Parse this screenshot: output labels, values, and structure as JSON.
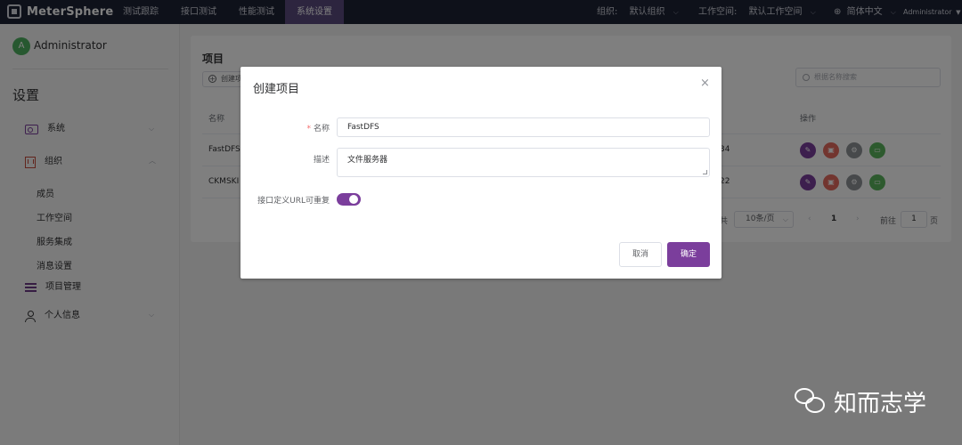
{
  "brand": {
    "name": "MeterSphere"
  },
  "nav": {
    "items": [
      "测试跟踪",
      "接口测试",
      "性能测试",
      "系统设置"
    ],
    "active_index": 3,
    "org_label": "组织:",
    "org_value": "默认组织",
    "workspace_label": "工作空间:",
    "workspace_value": "默认工作空间",
    "language": "简体中文",
    "user": "Administrator"
  },
  "sidebar": {
    "avatar_letter": "A",
    "user_name": "Administrator",
    "section_title": "设置",
    "items": [
      {
        "label": "系统",
        "icon": "system-icon",
        "expanded": false
      },
      {
        "label": "组织",
        "icon": "organization-icon",
        "expanded": true
      },
      {
        "label": "项目管理",
        "icon": "list-icon",
        "expanded": false
      },
      {
        "label": "个人信息",
        "icon": "user-icon",
        "expanded": false
      }
    ],
    "org_children": [
      "成员",
      "工作空间",
      "服务集成",
      "消息设置"
    ]
  },
  "main": {
    "title": "项目",
    "create_button": "创建项",
    "search_placeholder": "根据名称搜索",
    "columns": {
      "name": "名称",
      "operations": "操作"
    },
    "rows": [
      {
        "name": "FastDFS",
        "trailing": "34"
      },
      {
        "name": "CKMSKI",
        "trailing": "22"
      }
    ],
    "pagination": {
      "total_suffix": "共",
      "page_size": "10条/页",
      "current_page": "1",
      "goto_label": "前往",
      "goto_value": "1",
      "page_unit": "页"
    }
  },
  "modal": {
    "title": "创建项目",
    "close_icon": "close-icon",
    "name_label": "名称",
    "name_value": "FastDFS",
    "desc_label": "描述",
    "desc_value": "文件服务器",
    "repeat_label": "接口定义URL可重复",
    "repeat_enabled": true,
    "cancel_label": "取消",
    "confirm_label": "确定"
  },
  "watermark": {
    "text": "知而志学"
  },
  "colors": {
    "accent": "#7b3e9c",
    "nav_bg": "#1d2235",
    "danger": "#e46a5e",
    "success": "#5bb55c",
    "avatar": "#4fb160"
  }
}
